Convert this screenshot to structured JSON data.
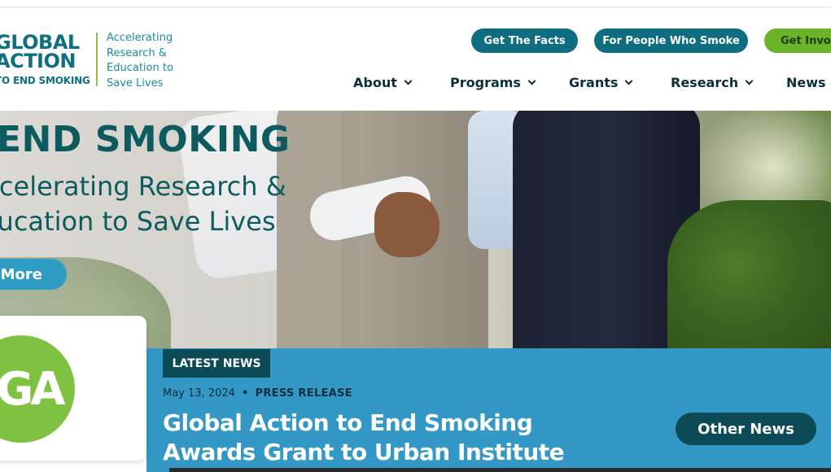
{
  "header": {
    "logo": {
      "line1": "GLOBAL",
      "line2": "ACTION",
      "line3": "TO END SMOKING",
      "tagline": "Accelerating Research & Education to Save Lives"
    },
    "buttons": {
      "facts": "Get The Facts",
      "people": "For People Who Smoke",
      "involved": "Get Involved"
    },
    "nav": [
      {
        "label": "About"
      },
      {
        "label": "Programs"
      },
      {
        "label": "Grants"
      },
      {
        "label": "Research"
      },
      {
        "label": "News and"
      }
    ]
  },
  "hero": {
    "title": "END SMOKING",
    "subtitle_line1": "Accelerating Research &",
    "subtitle_line2": "Education to Save Lives",
    "cta": "More"
  },
  "news": {
    "logo_text": "GA",
    "tag": "LATEST NEWS",
    "date": "May 13, 2024",
    "separator": "•",
    "kind": "PRESS RELEASE",
    "headline": "Global Action to End Smoking Awards Grant to Urban Institute",
    "other_button": "Other News"
  },
  "colors": {
    "brand_teal": "#0e6e80",
    "brand_green": "#6ab42a",
    "news_blue": "#3398c5",
    "dark_teal": "#0c4a55"
  }
}
